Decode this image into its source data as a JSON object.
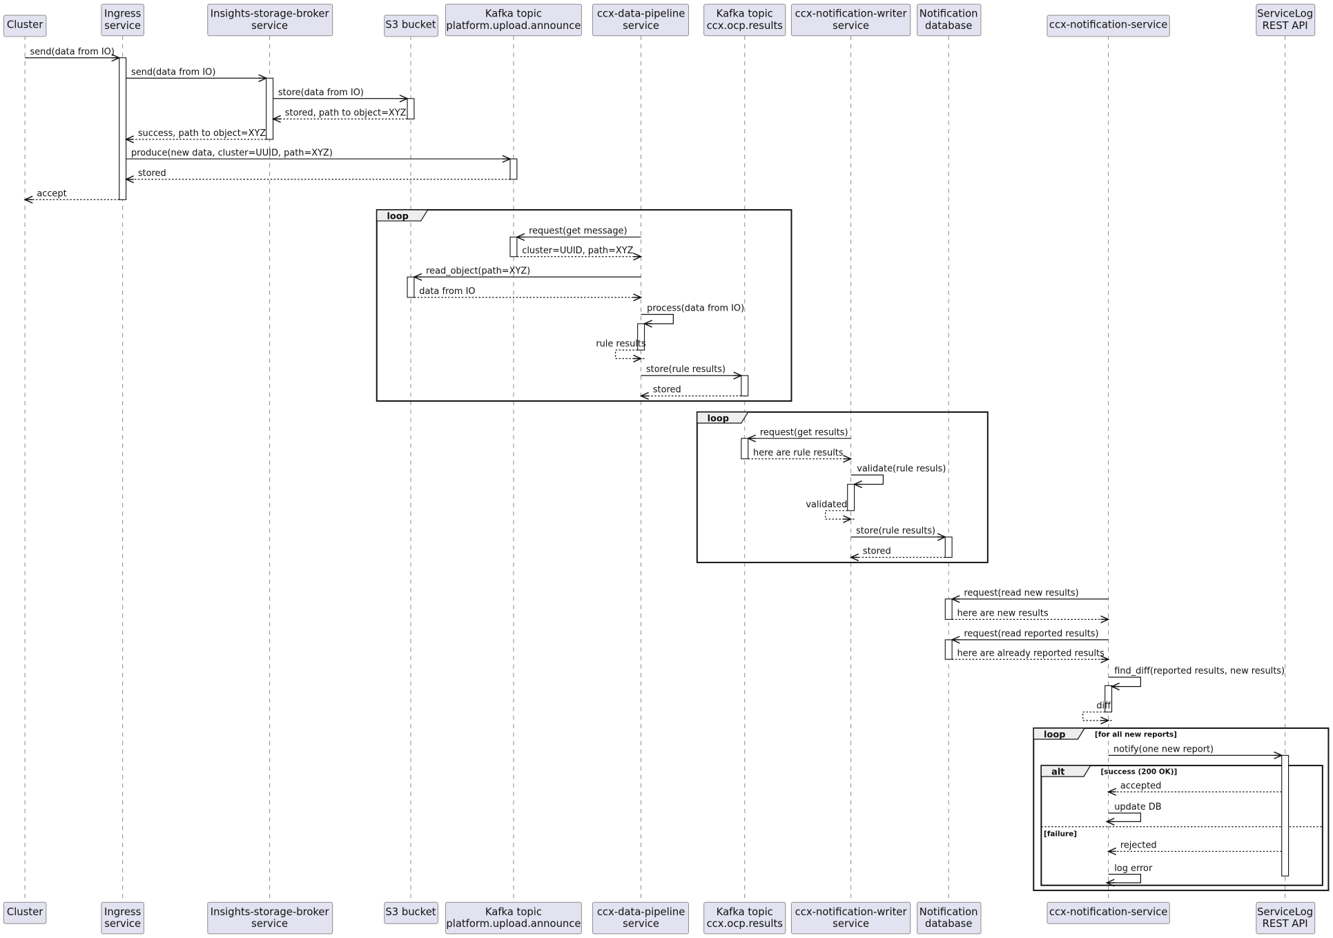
{
  "participants": [
    {
      "id": "cluster",
      "lines": [
        "Cluster"
      ]
    },
    {
      "id": "ingress",
      "lines": [
        "Ingress",
        "service"
      ]
    },
    {
      "id": "isb",
      "lines": [
        "Insights-storage-broker",
        "service"
      ]
    },
    {
      "id": "s3",
      "lines": [
        "S3 bucket"
      ]
    },
    {
      "id": "kafka_upload",
      "lines": [
        "Kafka topic",
        "platform.upload.announce"
      ]
    },
    {
      "id": "pipeline",
      "lines": [
        "ccx-data-pipeline",
        "service"
      ]
    },
    {
      "id": "kafka_results",
      "lines": [
        "Kafka topic",
        "ccx.ocp.results"
      ]
    },
    {
      "id": "writer",
      "lines": [
        "ccx-notification-writer",
        "service"
      ]
    },
    {
      "id": "notif_db",
      "lines": [
        "Notification",
        "database"
      ]
    },
    {
      "id": "notif_service",
      "lines": [
        "ccx-notification-service"
      ]
    },
    {
      "id": "servicelog",
      "lines": [
        "ServiceLog",
        "REST API"
      ]
    }
  ],
  "messages": [
    {
      "from": "cluster",
      "to": "ingress",
      "label": "send(data from IO)",
      "type": "sync"
    },
    {
      "from": "ingress",
      "to": "isb",
      "label": "send(data from IO)",
      "type": "sync"
    },
    {
      "from": "isb",
      "to": "s3",
      "label": "store(data from IO)",
      "type": "sync"
    },
    {
      "from": "s3",
      "to": "isb",
      "label": "stored, path to object=XYZ",
      "type": "return"
    },
    {
      "from": "isb",
      "to": "ingress",
      "label": "success, path to object=XYZ",
      "type": "return"
    },
    {
      "from": "ingress",
      "to": "kafka_upload",
      "label": "produce(new data, cluster=UUID, path=XYZ)",
      "type": "sync"
    },
    {
      "from": "kafka_upload",
      "to": "ingress",
      "label": "stored",
      "type": "return"
    },
    {
      "from": "ingress",
      "to": "cluster",
      "label": "accept",
      "type": "return"
    },
    {
      "from": "pipeline",
      "to": "kafka_upload",
      "label": "request(get message)",
      "type": "sync"
    },
    {
      "from": "kafka_upload",
      "to": "pipeline",
      "label": "cluster=UUID, path=XYZ",
      "type": "return"
    },
    {
      "from": "pipeline",
      "to": "s3",
      "label": "read_object(path=XYZ)",
      "type": "sync"
    },
    {
      "from": "s3",
      "to": "pipeline",
      "label": "data from IO",
      "type": "return"
    },
    {
      "from": "pipeline",
      "to": "pipeline",
      "label": "process(data from IO)",
      "type": "self"
    },
    {
      "from": "pipeline",
      "to": "pipeline",
      "label": "rule results",
      "type": "self-return"
    },
    {
      "from": "pipeline",
      "to": "kafka_results",
      "label": "store(rule results)",
      "type": "sync"
    },
    {
      "from": "kafka_results",
      "to": "pipeline",
      "label": "stored",
      "type": "return"
    },
    {
      "from": "writer",
      "to": "kafka_results",
      "label": "request(get results)",
      "type": "sync"
    },
    {
      "from": "kafka_results",
      "to": "writer",
      "label": "here are rule results",
      "type": "return"
    },
    {
      "from": "writer",
      "to": "writer",
      "label": "validate(rule resuls)",
      "type": "self"
    },
    {
      "from": "writer",
      "to": "writer",
      "label": "validated",
      "type": "self-return"
    },
    {
      "from": "writer",
      "to": "notif_db",
      "label": "store(rule results)",
      "type": "sync"
    },
    {
      "from": "notif_db",
      "to": "writer",
      "label": "stored",
      "type": "return"
    },
    {
      "from": "notif_service",
      "to": "notif_db",
      "label": "request(read new results)",
      "type": "sync"
    },
    {
      "from": "notif_db",
      "to": "notif_service",
      "label": "here are new results",
      "type": "return"
    },
    {
      "from": "notif_service",
      "to": "notif_db",
      "label": "request(read reported results)",
      "type": "sync"
    },
    {
      "from": "notif_db",
      "to": "notif_service",
      "label": "here are already reported results",
      "type": "return"
    },
    {
      "from": "notif_service",
      "to": "notif_service",
      "label": "find_diff(reported results, new results)",
      "type": "self"
    },
    {
      "from": "notif_service",
      "to": "notif_service",
      "label": "diff",
      "type": "self-return"
    },
    {
      "from": "notif_service",
      "to": "servicelog",
      "label": "notify(one new report)",
      "type": "sync"
    },
    {
      "from": "servicelog",
      "to": "notif_service",
      "label": "accepted",
      "type": "return"
    },
    {
      "from": "notif_service",
      "to": "notif_service",
      "label": "update DB",
      "type": "self-plain"
    },
    {
      "from": "servicelog",
      "to": "notif_service",
      "label": "rejected",
      "type": "return"
    },
    {
      "from": "notif_service",
      "to": "notif_service",
      "label": "log error",
      "type": "self-plain"
    }
  ],
  "fragments": [
    {
      "kind": "loop",
      "condition": ""
    },
    {
      "kind": "loop",
      "condition": ""
    },
    {
      "kind": "loop",
      "condition": "[for all new reports]"
    },
    {
      "kind": "alt",
      "condition": "[success (200 OK)]",
      "else_condition": "[failure]"
    }
  ]
}
